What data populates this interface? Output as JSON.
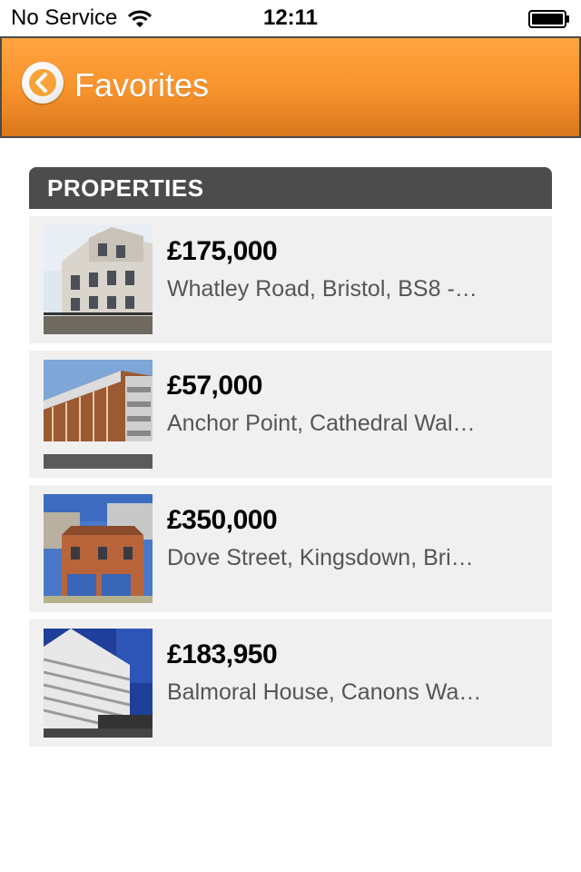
{
  "status_bar": {
    "carrier": "No Service",
    "time": "12:11"
  },
  "nav": {
    "title": "Favorites"
  },
  "section": {
    "title": "PROPERTIES"
  },
  "properties": [
    {
      "price": "£175,000",
      "address": "Whatley Road, Bristol, BS8 -…"
    },
    {
      "price": "£57,000",
      "address": "Anchor Point, Cathedral Wal…"
    },
    {
      "price": "£350,000",
      "address": "Dove Street, Kingsdown, Bri…"
    },
    {
      "price": "£183,950",
      "address": "Balmoral House, Canons Wa…"
    }
  ],
  "colors": {
    "nav_orange": "#f7922c",
    "section_header": "#4c4c4c",
    "row_background": "#f0f0f0"
  }
}
